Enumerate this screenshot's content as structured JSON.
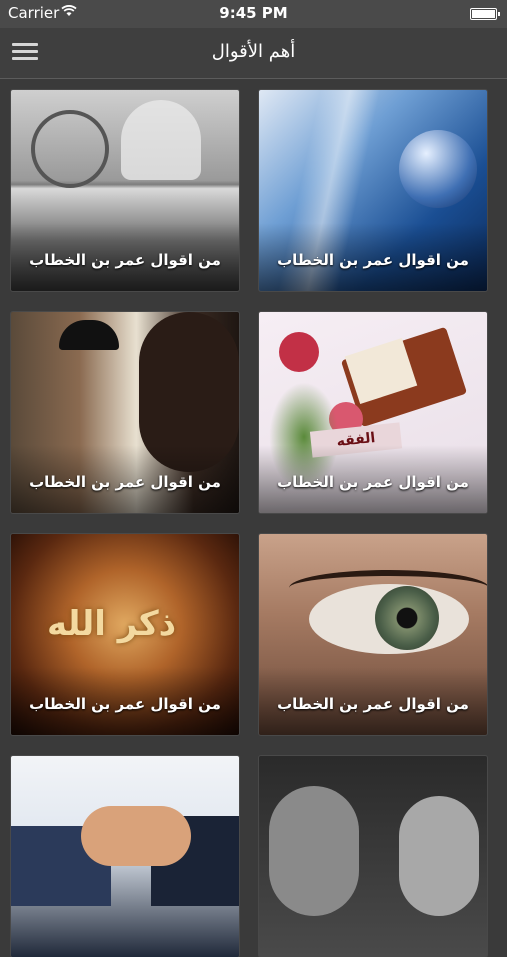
{
  "status_bar": {
    "carrier": "Carrier",
    "time": "9:45 PM",
    "battery_level": 0.9
  },
  "nav": {
    "title": "أهم الأقوال"
  },
  "cards": [
    {
      "caption": "من اقوال عمر بن الخطاب",
      "icon": "elderly-care-photo"
    },
    {
      "caption": "من اقوال عمر بن الخطاب",
      "icon": "blue-water-orb-photo"
    },
    {
      "caption": "من اقوال عمر بن الخطاب",
      "icon": "men-praying-photo"
    },
    {
      "caption": "من اقوال عمر بن الخطاب",
      "icon": "quran-stand-photo",
      "overlay_label": "الفقه"
    },
    {
      "caption": "من اقوال عمر بن الخطاب",
      "icon": "dhikr-calligraphy-photo",
      "overlay_label": "ذكر الله"
    },
    {
      "caption": "من اقوال عمر بن الخطاب",
      "icon": "eye-closeup-photo"
    },
    {
      "caption": "",
      "icon": "handshake-photo"
    },
    {
      "caption": "",
      "icon": "two-faces-photo"
    }
  ],
  "colors": {
    "background": "#3a3a3a",
    "nav": "#3f3f3f",
    "status": "#4a4a4a"
  }
}
